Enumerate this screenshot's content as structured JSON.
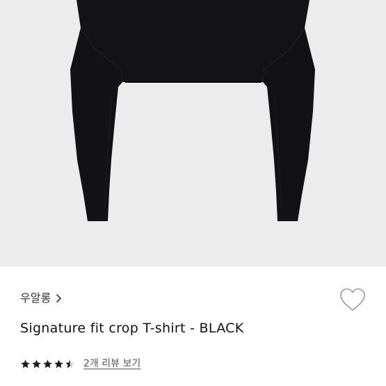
{
  "product": {
    "brand": "우알롱",
    "title": "Signature fit crop T-shirt - BLACK",
    "rating": 4.5,
    "rating_max": 5,
    "review_link": "2개 리뷰 보기",
    "color": "#121217"
  },
  "icons": {
    "brand_chevron": "chevron-right-icon",
    "wishlist": "heart-outline-icon",
    "star": "star-icon"
  },
  "colors": {
    "image_background": "#ececec",
    "star_filled": "#1a1a1a",
    "star_empty": "#cfcfcf",
    "heart_stroke": "#9a9a9a"
  }
}
